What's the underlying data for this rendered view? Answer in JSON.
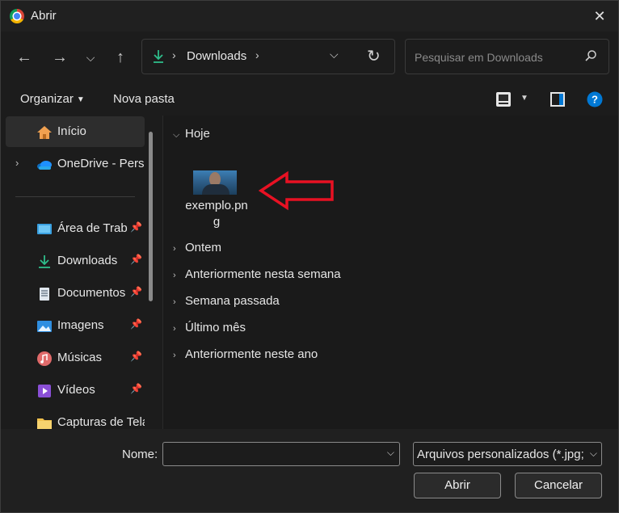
{
  "window": {
    "title": "Abrir"
  },
  "nav": {
    "breadcrumb": "Downloads",
    "search_placeholder": "Pesquisar em Downloads"
  },
  "toolbar": {
    "organize_label": "Organizar",
    "new_folder_label": "Nova pasta"
  },
  "sidebar": {
    "items": [
      {
        "label": "Início",
        "icon": "home-icon"
      },
      {
        "label": "OneDrive - Perso",
        "icon": "onedrive-icon"
      },
      {
        "label": "Área de Trab",
        "icon": "desktop-icon"
      },
      {
        "label": "Downloads",
        "icon": "download-icon"
      },
      {
        "label": "Documentos",
        "icon": "documents-icon"
      },
      {
        "label": "Imagens",
        "icon": "pictures-icon"
      },
      {
        "label": "Músicas",
        "icon": "music-icon"
      },
      {
        "label": "Vídeos",
        "icon": "videos-icon"
      },
      {
        "label": "Capturas de Tela",
        "icon": "folder-icon"
      }
    ]
  },
  "content": {
    "groups": [
      {
        "label": "Hoje",
        "expanded": true
      },
      {
        "label": "Ontem"
      },
      {
        "label": "Anteriormente nesta semana"
      },
      {
        "label": "Semana passada"
      },
      {
        "label": "Último mês"
      },
      {
        "label": "Anteriormente neste ano"
      }
    ],
    "file": {
      "name": "exemplo.png"
    }
  },
  "bottom": {
    "name_label": "Nome:",
    "name_value": "",
    "filter_value": "Arquivos personalizados (*.jpg;*",
    "open_label": "Abrir",
    "cancel_label": "Cancelar"
  },
  "colors": {
    "accent": "#0078d4",
    "annotation_arrow": "#e81123",
    "download_green": "#2ebd8a"
  }
}
